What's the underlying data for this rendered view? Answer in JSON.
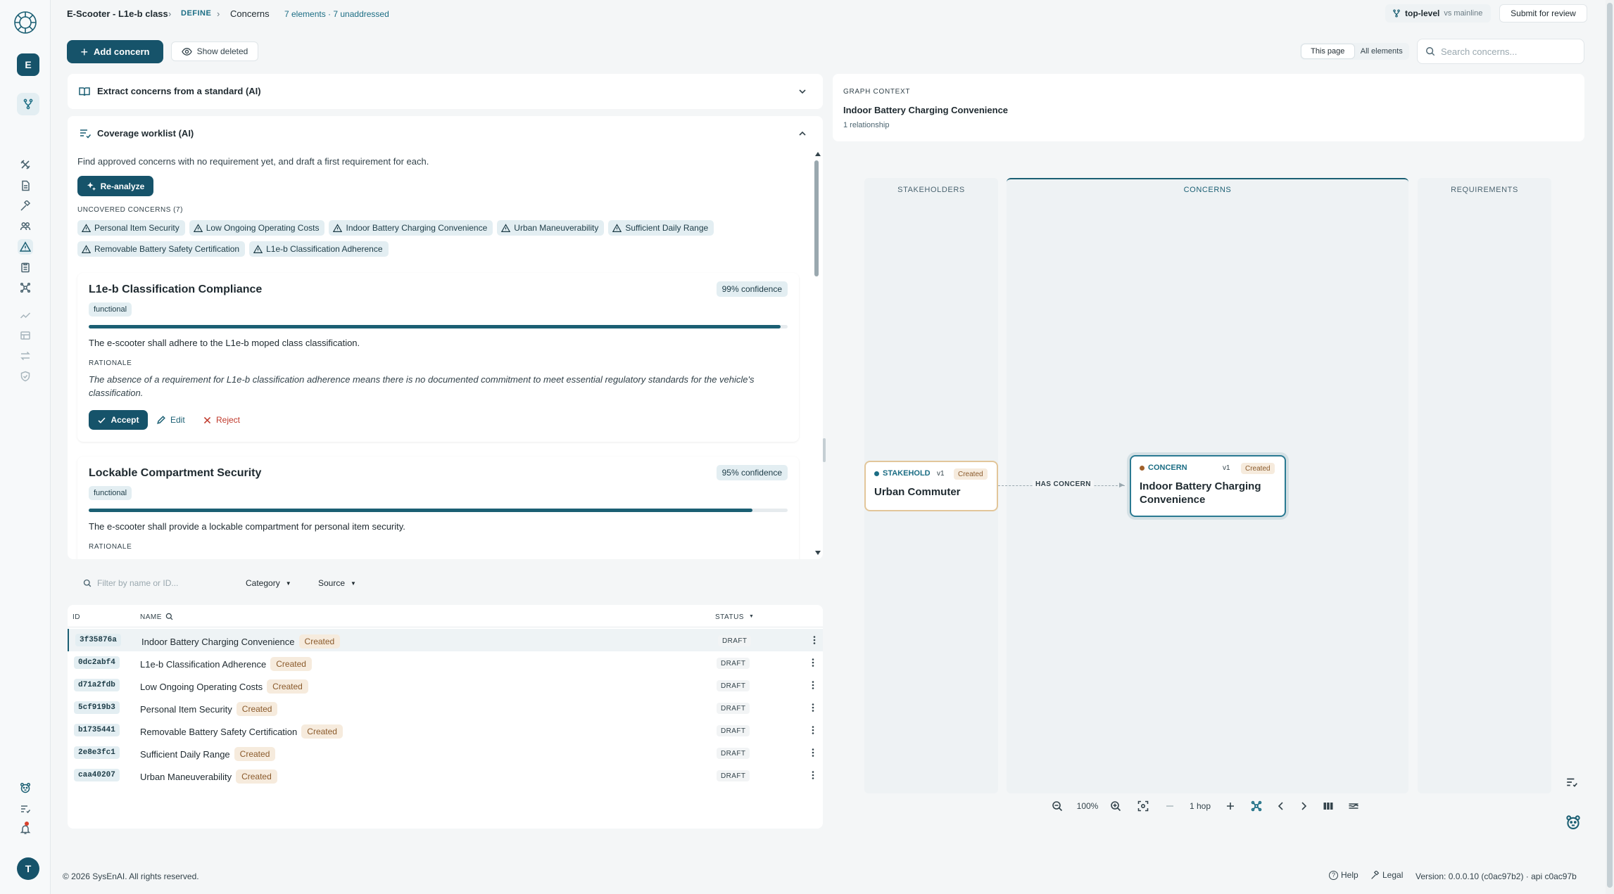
{
  "breadcrumb": {
    "project": "E-Scooter - L1e-b class",
    "phase": "DEFINE",
    "page": "Concerns",
    "summary": "7 elements · 7 unaddressed"
  },
  "branch": {
    "name": "top-level",
    "compare": "vs mainline"
  },
  "submit_label": "Submit for review",
  "rail": {
    "workspace_initial": "E",
    "user_initial": "T"
  },
  "toolbar": {
    "add_label": "Add concern",
    "show_deleted_label": "Show deleted",
    "scope": [
      "This page",
      "All elements"
    ],
    "search_placeholder": "Search concerns..."
  },
  "extract": {
    "title": "Extract concerns from a standard (AI)"
  },
  "worklist": {
    "title": "Coverage worklist (AI)",
    "description": "Find approved concerns with no requirement yet, and draft a first requirement for each.",
    "reanalyze_label": "Re-analyze",
    "uncovered_label": "UNCOVERED CONCERNS (7)",
    "uncovered": [
      "Personal Item Security",
      "Low Ongoing Operating Costs",
      "Indoor Battery Charging Convenience",
      "Urban Maneuverability",
      "Sufficient Daily Range",
      "Removable Battery Safety Certification",
      "L1e-b Classification Adherence"
    ],
    "suggestions": [
      {
        "title": "L1e-b Classification Compliance",
        "confidence_label": "99% confidence",
        "confidence": 0.99,
        "category": "functional",
        "text": "The e-scooter shall adhere to the L1e-b moped class classification.",
        "rationale_label": "RATIONALE",
        "rationale": "The absence of a requirement for L1e-b classification adherence means there is no documented commitment to meet essential regulatory standards for the vehicle's classification.",
        "accept": "Accept",
        "edit": "Edit",
        "reject": "Reject"
      },
      {
        "title": "Lockable Compartment Security",
        "confidence_label": "95% confidence",
        "confidence": 0.95,
        "category": "functional",
        "text": "The e-scooter shall provide a lockable compartment for personal item security.",
        "rationale_label": "RATIONALE"
      }
    ]
  },
  "filters": {
    "placeholder": "Filter by name or ID...",
    "category": "Category",
    "source": "Source"
  },
  "table": {
    "headers": {
      "id": "ID",
      "name": "NAME",
      "status": "STATUS"
    },
    "rows": [
      {
        "id": "3f35876a",
        "name": "Indoor Battery Charging Convenience",
        "badge": "Created",
        "status": "DRAFT"
      },
      {
        "id": "0dc2abf4",
        "name": "L1e-b Classification Adherence",
        "badge": "Created",
        "status": "DRAFT"
      },
      {
        "id": "d71a2fdb",
        "name": "Low Ongoing Operating Costs",
        "badge": "Created",
        "status": "DRAFT"
      },
      {
        "id": "5cf919b3",
        "name": "Personal Item Security",
        "badge": "Created",
        "status": "DRAFT"
      },
      {
        "id": "b1735441",
        "name": "Removable Battery Safety Certification",
        "badge": "Created",
        "status": "DRAFT"
      },
      {
        "id": "2e8e3fc1",
        "name": "Sufficient Daily Range",
        "badge": "Created",
        "status": "DRAFT"
      },
      {
        "id": "caa40207",
        "name": "Urban Maneuverability",
        "badge": "Created",
        "status": "DRAFT"
      }
    ]
  },
  "graph": {
    "context_label": "GRAPH CONTEXT",
    "selected": "Indoor Battery Charging Convenience",
    "relationships": "1 relationship",
    "lanes": [
      "STAKEHOLDERS",
      "CONCERNS",
      "REQUIREMENTS"
    ],
    "stakeholder_node": {
      "type": "STAKEHOLD",
      "version": "v1",
      "badge": "Created",
      "title": "Urban Commuter"
    },
    "concern_node": {
      "type": "CONCERN",
      "version": "v1",
      "badge": "Created",
      "title": "Indoor Battery Charging Convenience"
    },
    "edge_label": "HAS CONCERN",
    "zoom": "100%",
    "hops": "1 hop"
  },
  "footer": {
    "copyright": "© 2026 SysEnAI. All rights reserved.",
    "help": "Help",
    "legal": "Legal",
    "version": "Version: 0.0.0.10 (c0ac97b2) · api c0ac97b"
  },
  "colors": {
    "primary": "#16536a",
    "chip_bg": "#e3eef2",
    "created_bg": "#f6ebdd",
    "created_text": "#8a5a2b",
    "reject": "#c0392b"
  }
}
